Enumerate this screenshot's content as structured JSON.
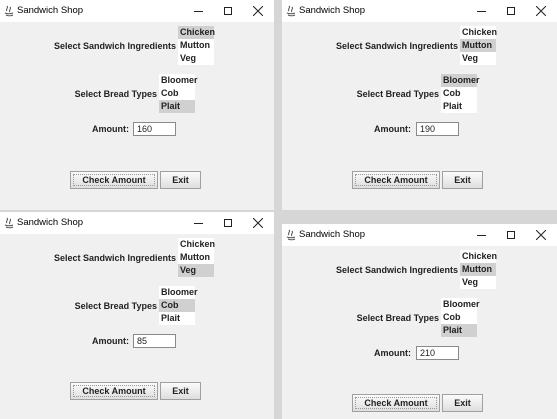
{
  "windows": [
    {
      "title": "Sandwich Shop",
      "ingredients_label": "Select Sandwich Ingredients",
      "ingredients": [
        {
          "label": "Chicken",
          "selected": true
        },
        {
          "label": "Mutton",
          "selected": false
        },
        {
          "label": "Veg",
          "selected": false
        }
      ],
      "bread_label": "Select Bread Types",
      "breads": [
        {
          "label": "Bloomer",
          "selected": false
        },
        {
          "label": "Cob",
          "selected": false
        },
        {
          "label": "Plait",
          "selected": true
        }
      ],
      "amount_label": "Amount:",
      "amount_value": "160",
      "check_label": "Check Amount",
      "exit_label": "Exit"
    },
    {
      "title": "Sandwich Shop",
      "ingredients_label": "Select Sandwich Ingredients",
      "ingredients": [
        {
          "label": "Chicken",
          "selected": false
        },
        {
          "label": "Mutton",
          "selected": true
        },
        {
          "label": "Veg",
          "selected": false
        }
      ],
      "bread_label": "Select Bread Types",
      "breads": [
        {
          "label": "Bloomer",
          "selected": true
        },
        {
          "label": "Cob",
          "selected": false
        },
        {
          "label": "Plait",
          "selected": false
        }
      ],
      "amount_label": "Amount:",
      "amount_value": "190",
      "check_label": "Check Amount",
      "exit_label": "Exit"
    },
    {
      "title": "Sandwich Shop",
      "ingredients_label": "Select Sandwich Ingredients",
      "ingredients": [
        {
          "label": "Chicken",
          "selected": false
        },
        {
          "label": "Mutton",
          "selected": false
        },
        {
          "label": "Veg",
          "selected": true
        }
      ],
      "bread_label": "Select Bread Types",
      "breads": [
        {
          "label": "Bloomer",
          "selected": false
        },
        {
          "label": "Cob",
          "selected": true
        },
        {
          "label": "Plait",
          "selected": false
        }
      ],
      "amount_label": "Amount:",
      "amount_value": "85",
      "check_label": "Check Amount",
      "exit_label": "Exit"
    },
    {
      "title": "Sandwich Shop",
      "ingredients_label": "Select Sandwich Ingredients",
      "ingredients": [
        {
          "label": "Chicken",
          "selected": false
        },
        {
          "label": "Mutton",
          "selected": true
        },
        {
          "label": "Veg",
          "selected": false
        }
      ],
      "bread_label": "Select Bread Types",
      "breads": [
        {
          "label": "Bloomer",
          "selected": false
        },
        {
          "label": "Cob",
          "selected": false
        },
        {
          "label": "Plait",
          "selected": true
        }
      ],
      "amount_label": "Amount:",
      "amount_value": "210",
      "check_label": "Check Amount",
      "exit_label": "Exit"
    }
  ]
}
